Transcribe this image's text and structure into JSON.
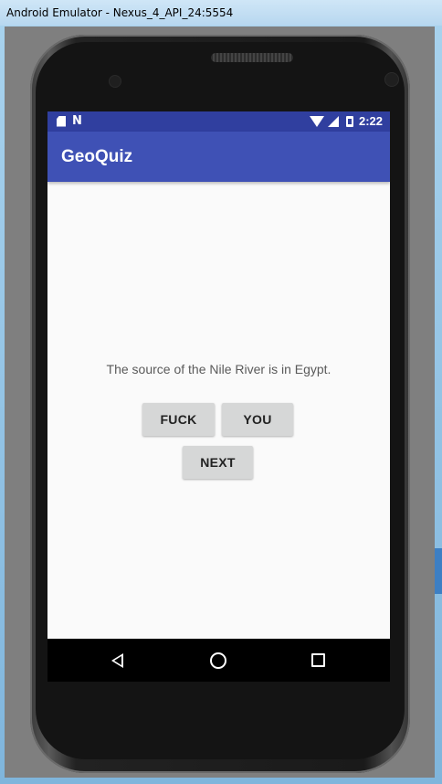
{
  "window": {
    "title": "Android Emulator - Nexus_4_API_24:5554"
  },
  "status_bar": {
    "time": "2:22",
    "left_icons": [
      "sd-card-icon",
      "n-notification-icon"
    ],
    "right_icons": [
      "wifi-icon",
      "signal-icon",
      "battery-icon"
    ]
  },
  "app_bar": {
    "title": "GeoQuiz"
  },
  "quiz": {
    "question": "The source of the Nile River is in Egypt.",
    "true_label": "FUCK",
    "false_label": "YOU",
    "next_label": "NEXT"
  },
  "nav_bar": {
    "icons": [
      "back-icon",
      "home-icon",
      "recents-icon"
    ]
  },
  "colors": {
    "status_bar": "#303f9f",
    "app_bar": "#3f51b5",
    "screen_bg": "#fafafa",
    "button_bg": "#d6d7d7"
  }
}
